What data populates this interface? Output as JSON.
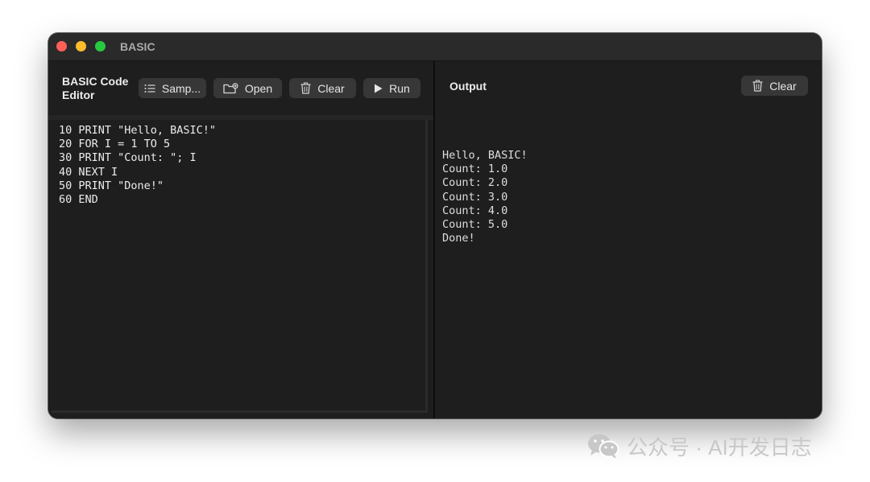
{
  "window": {
    "title": "BASIC"
  },
  "editor": {
    "title": "BASIC Code Editor",
    "toolbar": {
      "sample_label": "Samp...",
      "open_label": "Open",
      "clear_label": "Clear",
      "run_label": "Run"
    },
    "code_lines": [
      "10 PRINT \"Hello, BASIC!\"",
      "20 FOR I = 1 TO 5",
      "30 PRINT \"Count: \"; I",
      "40 NEXT I",
      "50 PRINT \"Done!\"",
      "60 END"
    ]
  },
  "output": {
    "title": "Output",
    "clear_label": "Clear",
    "lines": [
      "Hello, BASIC!",
      "Count: 1.0",
      "Count: 2.0",
      "Count: 3.0",
      "Count: 4.0",
      "Count: 5.0",
      "Done!"
    ]
  },
  "watermark": {
    "text": "公众号 · AI开发日志"
  },
  "colors": {
    "background": "#1e1e1e",
    "titlebar": "#2a2a2a",
    "button": "#373737",
    "text": "#ececec",
    "traffic_close": "#ff5f57",
    "traffic_minimize": "#febc2e",
    "traffic_maximize": "#28c840"
  },
  "icons": {
    "sample": "list-icon",
    "open": "folder-icon",
    "clear": "trash-icon",
    "run": "play-icon",
    "watermark": "wechat-icon"
  }
}
